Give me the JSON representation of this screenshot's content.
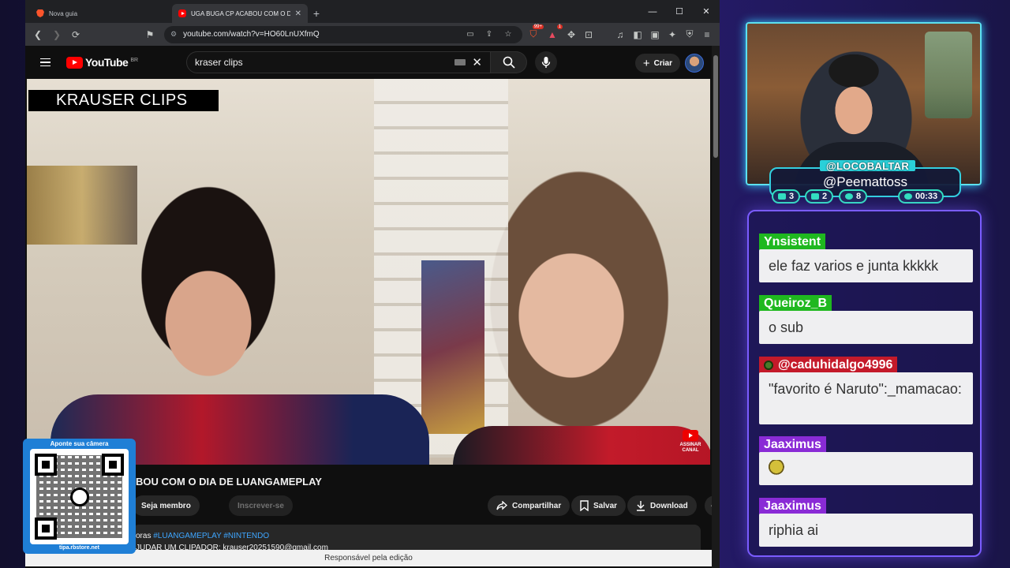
{
  "browser": {
    "tabs": [
      {
        "title": "Nova guia",
        "active": false,
        "icon": "brave-icon"
      },
      {
        "title": "UGA BUGA CP ACABOU COM O DIA",
        "active": true,
        "icon": "youtube-favicon"
      }
    ],
    "new_tab": "+",
    "url": "youtube.com/watch?v=HO60LnUXfmQ",
    "shields_badge": "99+",
    "rewards_badge": "1"
  },
  "youtube": {
    "logo_text": "YouTube",
    "region": "BR",
    "search_query": "kraser clips",
    "create_label": "Criar",
    "video_overlay_label": "KRAUSER CLIPS",
    "subscribe_watermark": "ASSINAR CANAL",
    "video_title": "BOU COM O DIA DE LUANGAMEPLAY",
    "buttons": {
      "member": "Seja membro",
      "subscribe": "Inscrever-se",
      "share": "Compartilhar",
      "save": "Salvar",
      "download": "Download",
      "more": "•••"
    },
    "description": {
      "prefix": "oras",
      "tags": "#LUANGAMEPLAY #NINTENDO",
      "line2": "JUDAR UM CLIPADOR: krauser20251590@gmail.com"
    },
    "bottom_bar": "Responsável pela edição"
  },
  "qr": {
    "top_text": "Aponte sua câmera",
    "bottom_text": "tipa.rbstore.net"
  },
  "stream": {
    "channel_tag": "@LOCOBALTAR",
    "handle": "@Peemattoss",
    "stats": [
      {
        "icon": "chat-icon",
        "value": "3"
      },
      {
        "icon": "youtube-icon",
        "value": "2"
      },
      {
        "icon": "follow-icon",
        "value": "8"
      },
      {
        "icon": "clock-icon",
        "value": "00:33"
      }
    ]
  },
  "chat": {
    "messages": [
      {
        "user": "Ynsistent",
        "text": "ele faz varios e junta kkkkk",
        "user_color": "#1fb81f"
      },
      {
        "user": "Queiroz_B",
        "text": "o sub",
        "user_color": "#1fb81f"
      },
      {
        "user": "@caduhidalgo4996",
        "text": "\"favorito é Naruto\":_mamacao:",
        "user_color": "#c41a2a"
      },
      {
        "user": "Jaaximus",
        "text": "",
        "user_color": "#8a2bd6",
        "emote": "pepe-emote"
      },
      {
        "user": "Jaaximus",
        "text": "riphia ai",
        "user_color": "#8a2bd6"
      }
    ]
  },
  "colors": {
    "youtube_red": "#ff0000",
    "link_blue": "#3ea6ff",
    "overlay_cyan": "#33cfe0",
    "chat_border": "#7a5cff"
  }
}
